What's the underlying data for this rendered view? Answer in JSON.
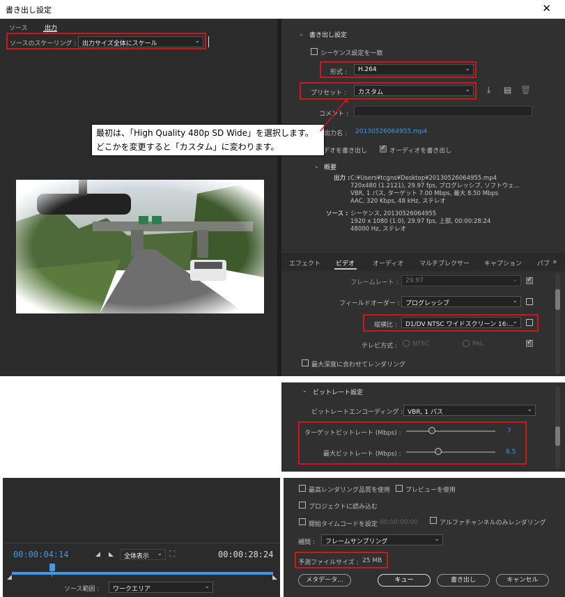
{
  "window": {
    "title": "書き出し設定",
    "close_glyph": "✕"
  },
  "left_tabs": {
    "source": "ソース",
    "output": "出力"
  },
  "scaling": {
    "label": "ソースのスケーリング :",
    "value": "出力サイズ全体にスケール"
  },
  "export_settings": {
    "header": "書き出し設定",
    "match_sequence": "シーケンス設定を一致",
    "format_label": "形式 :",
    "format_value": "H.264",
    "preset_label": "プリセット :",
    "preset_value": "カスタム",
    "comment_label": "コメント :",
    "output_name_label": "出力名 :",
    "output_name_value": "20130526064955.mp4",
    "export_video": "デオを書き出し",
    "export_audio": "オーディオを書き出し"
  },
  "callout": {
    "line1": "最初は、「High Quality 480p SD Wide」を選択します。",
    "line2": "どこかを変更すると「カスタム」に変わります。"
  },
  "summary": {
    "header": "概要",
    "output_label": "出力 :",
    "output_lines": [
      "C:¥Users¥tcgns¥Desktop¥20130526064955.mp4",
      "720x480 (1.2121), 29.97 fps, プログレッシブ, ソフトウェ...",
      "VBR, 1 パス, ターゲット 7.00 Mbps, 最大 8.50 Mbps",
      "AAC, 320 Kbps, 48 kHz, ステレオ"
    ],
    "source_label": "ソース :",
    "source_lines": [
      "シーケンス, 20130526064955",
      "1920 x 1080 (1.0), 29.97 fps, 上部, 00:00:28:24",
      "48000 Hz, ステレオ"
    ]
  },
  "right_tabs": [
    "エフェクト",
    "ビデオ",
    "オーディオ",
    "マルチプレクサー",
    "キャプション",
    "パブ"
  ],
  "video": {
    "frame_rate_label": "フレームレート :",
    "frame_rate_value": "29.97",
    "field_order_label": "フィールドオーダー :",
    "field_order_value": "プログレッシブ",
    "aspect_label": "縦横比 :",
    "aspect_value": "D1/DV NTSC ワイドスクリーン 16:...",
    "tv_label": "テレビ方式 :",
    "tv_ntsc": "NTSC",
    "tv_pal": "PAL",
    "max_depth": "最大深度に合わせてレンダリング"
  },
  "bitrate": {
    "header": "ビットレート設定",
    "encoding_label": "ビットレートエンコーディング :",
    "encoding_value": "VBR, 1 パス",
    "target_label": "ターゲットビットレート (Mbps) :",
    "target_value": "7",
    "max_label": "最大ビットレート (Mbps) :",
    "max_value": "8.5"
  },
  "bottom_options": {
    "max_quality": "最高レンダリング品質を使用",
    "use_preview": "プレビューを使用",
    "import_project": "プロジェクトに読み込む",
    "start_timecode": "開始タイムコードを設定",
    "start_timecode_value": "00:00:00:00",
    "alpha_only": "アルファチャンネルのみレンダリング",
    "interp_label": "補間 :",
    "interp_value": "フレームサンプリング",
    "filesize_label": "予測ファイルサイズ :",
    "filesize_value": "25 MB"
  },
  "buttons": {
    "metadata": "メタデータ...",
    "queue": "キュー",
    "export": "書き出し",
    "cancel": "キャンセル"
  },
  "timeline": {
    "current": "00:00:04:14",
    "end": "00:00:28:24",
    "zoom_value": "全体表示",
    "source_range_label": "ソース範囲 :",
    "source_range_value": "ワークエリア"
  }
}
